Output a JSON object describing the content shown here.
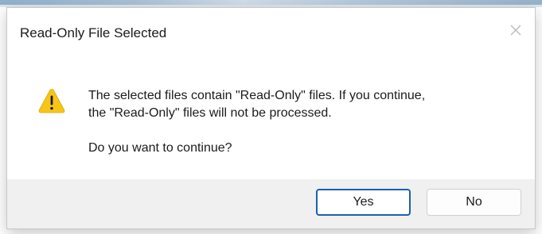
{
  "dialog": {
    "title": "Read-Only File Selected",
    "icon": "warning-icon",
    "message_line1": "The selected files contain \"Read-Only\" files.  If you continue,",
    "message_line2": "the \"Read-Only\" files will not be processed.",
    "question": "Do you want to continue?",
    "buttons": {
      "yes_label": "Yes",
      "no_label": "No"
    }
  },
  "colors": {
    "warning_fill": "#F7C518",
    "accent_border": "#1C5FB0",
    "footer_bg": "#F0F0F0"
  }
}
